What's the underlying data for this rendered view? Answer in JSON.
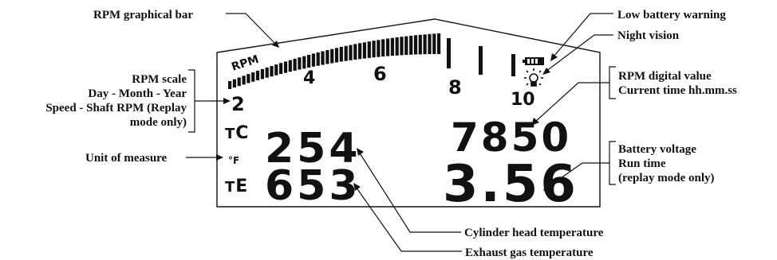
{
  "labels": {
    "rpm_bar": "RPM graphical bar",
    "low_battery": "Low battery warning",
    "night_vision": "Night vision",
    "rpm_scale_lines": [
      "RPM scale",
      "Day - Month - Year",
      "Speed - Shaft RPM (Replay",
      "mode only)"
    ],
    "rpm_digital_lines": [
      "RPM digital value",
      "Current time hh.mm.ss"
    ],
    "battery_lines": [
      "Battery voltage",
      "Run time",
      "(replay mode only)"
    ],
    "unit_of_measure": "Unit of measure",
    "cylinder_head": "Cylinder head temperature",
    "exhaust_gas": "Exhaust gas temperature"
  },
  "display": {
    "rpm_tag": "RPM",
    "scale_ticks": [
      "2",
      "4",
      "6",
      "8",
      "10"
    ],
    "tc_label": "T",
    "tc_sub": "C",
    "te_label": "T",
    "te_sub": "E",
    "unit": "°F",
    "cht_value": "254",
    "egt_value": "653",
    "rpm_value": "7850",
    "battery_value": "3.56",
    "battery_icon_text": "+"
  },
  "colors": {
    "ink": "#111111",
    "background": "#ffffff"
  }
}
